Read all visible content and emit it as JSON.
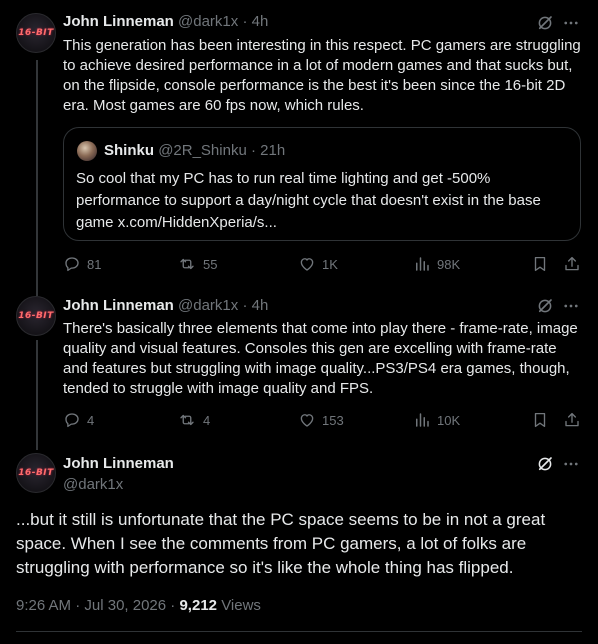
{
  "replies": [
    {
      "avatar_text": "16-BIT",
      "author": "John Linneman",
      "handle": "@dark1x",
      "sep": "·",
      "time": "4h",
      "text": "This generation has been interesting in this respect. PC gamers are struggling to achieve desired performance in a lot of modern games and that sucks but, on the flipside, console performance is the best it's been since the 16-bit 2D era. Most games are 60 fps now, which rules.",
      "quote": {
        "author": "Shinku",
        "handle": "@2R_Shinku",
        "sep": "·",
        "time": "21h",
        "text": "So cool that my PC has to run real time lighting and get -500% performance to support a day/night cycle that doesn't exist in the base game x.com/HiddenXperia/s..."
      },
      "stats": {
        "replies": "81",
        "reposts": "55",
        "likes": "1K",
        "views": "98K"
      }
    },
    {
      "avatar_text": "16-BIT",
      "author": "John Linneman",
      "handle": "@dark1x",
      "sep": "·",
      "time": "4h",
      "text": "There's basically three elements that come into play there - frame-rate, image quality and visual features. Consoles this gen are excelling with frame-rate and features but struggling with image quality...PS3/PS4 era games, though, tended to struggle with image quality and FPS.",
      "stats": {
        "replies": "4",
        "reposts": "4",
        "likes": "153",
        "views": "10K"
      }
    }
  ],
  "main_tweet": {
    "avatar_text": "16-BIT",
    "author": "John Linneman",
    "handle": "@dark1x",
    "text": "...but it still is unfortunate that the PC space seems to be in not a great space. When I see the comments from PC gamers, a lot of folks are struggling with performance so it's like the whole thing has flipped.",
    "time": "9:26 AM",
    "sep": "·",
    "date": "Jul 30, 2026",
    "sep2": "·",
    "views_count": "9,212",
    "views_label": "Views"
  },
  "colors": {
    "background": "#000000",
    "text": "#e7e9ea",
    "muted": "#71767b",
    "border": "#2f3336"
  }
}
